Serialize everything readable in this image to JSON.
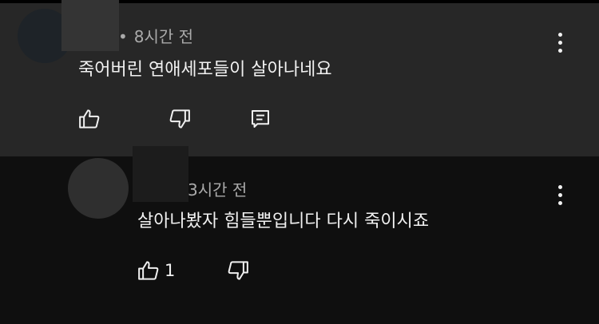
{
  "comments": [
    {
      "time": "8시간 전",
      "separator": "•",
      "text": "죽어버린 연애세포들이 살아나네요",
      "like_count": "",
      "actions": [
        "like-icon",
        "dislike-icon",
        "reply-icon"
      ]
    },
    {
      "time": "3시간 전",
      "text": "살아나봤자 힘들뿐입니다 다시 죽이시죠",
      "like_count": "1",
      "actions": [
        "like-icon",
        "dislike-icon"
      ]
    }
  ],
  "colors": {
    "page_background": "#0f0f0f",
    "highlighted_comment_background": "#272727",
    "primary_text": "#f1f1f1",
    "secondary_text": "#aaaaaa"
  }
}
